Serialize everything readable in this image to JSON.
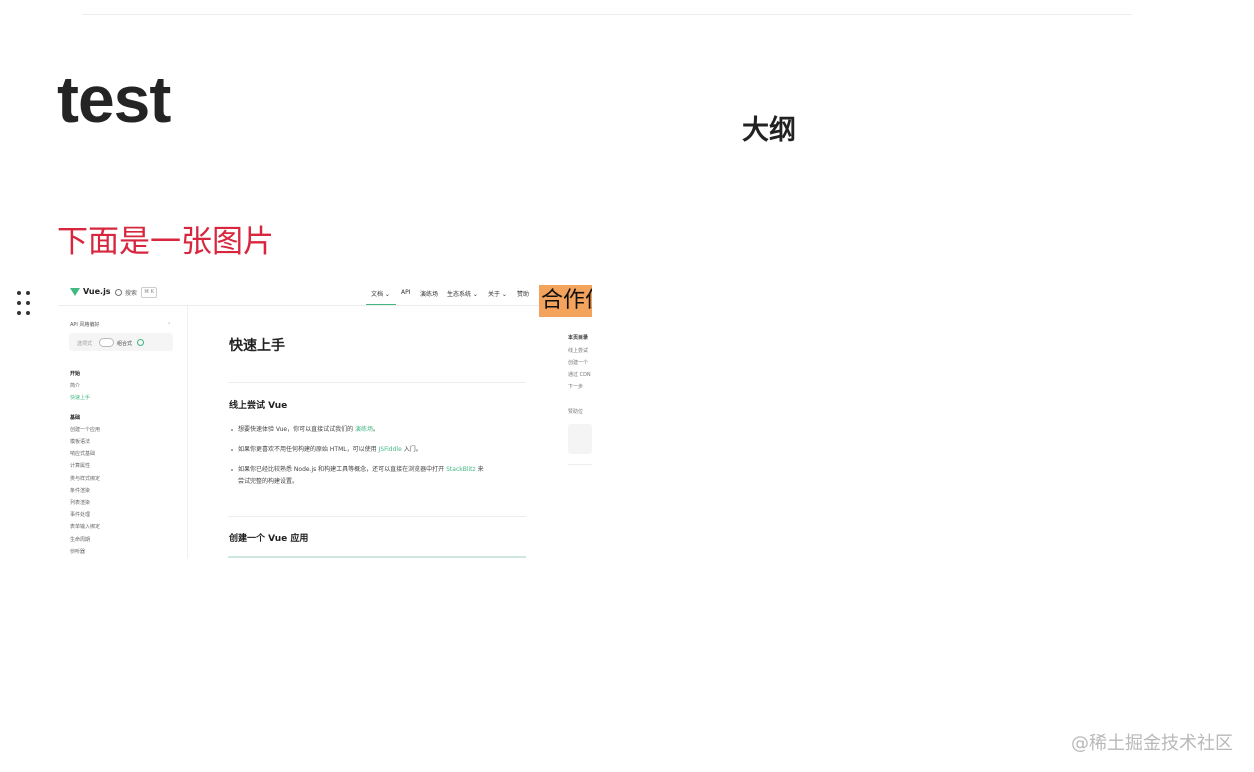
{
  "document": {
    "title": "test",
    "paragraph": "下面是一张图片"
  },
  "outline": {
    "title": "大纲"
  },
  "embedded_screenshot": {
    "nav": {
      "brand": "Vue.js",
      "search_label": "搜索",
      "search_kbd": "⌘ K",
      "links": [
        {
          "label": "文档 ⌄"
        },
        {
          "label": "API"
        },
        {
          "label": "演练场"
        },
        {
          "label": "生态系统 ⌄"
        },
        {
          "label": "关于 ⌄"
        },
        {
          "label": "赞助"
        }
      ],
      "badge": "合作伙伴"
    },
    "sidebar": {
      "pref_label": "API 风格偏好",
      "pref_chevron": "›",
      "option_off": "选项式",
      "option_on": "组合式",
      "items": [
        {
          "label": "开始",
          "kind": "sec"
        },
        {
          "label": "简介",
          "kind": "item"
        },
        {
          "label": "快速上手",
          "kind": "active"
        },
        {
          "label": "基础",
          "kind": "sec"
        },
        {
          "label": "创建一个应用",
          "kind": "item"
        },
        {
          "label": "模板语法",
          "kind": "item"
        },
        {
          "label": "响应式基础",
          "kind": "item"
        },
        {
          "label": "计算属性",
          "kind": "item"
        },
        {
          "label": "类与样式绑定",
          "kind": "item"
        },
        {
          "label": "条件渲染",
          "kind": "item"
        },
        {
          "label": "列表渲染",
          "kind": "item"
        },
        {
          "label": "事件处理",
          "kind": "item"
        },
        {
          "label": "表单输入绑定",
          "kind": "item"
        },
        {
          "label": "生命周期",
          "kind": "item"
        },
        {
          "label": "侦听器",
          "kind": "item"
        }
      ]
    },
    "main": {
      "h1": "快速上手",
      "section1": "线上尝试 Vue",
      "bullet1_pre": "想要快速体验 Vue，你可以直接试试我们的",
      "bullet1_link": "演练场",
      "bullet1_post": "。",
      "bullet2_pre": "如果你更喜欢不用任何构建的原始 HTML，可以使用",
      "bullet2_link": "JSFiddle",
      "bullet2_post": "入门。",
      "bullet3_pre": "如果你已经比较熟悉 Node.js 和构建工具等概念，还可以直接在浏览器中打开",
      "bullet3_link": "StackBlitz",
      "bullet3_post": "来",
      "bullet3_line2": "尝试完整的构建设置。",
      "section2": "创建一个 Vue 应用"
    },
    "toc": {
      "head": "本页目录",
      "items": [
        {
          "label": "线上尝试"
        },
        {
          "label": "创建一个"
        },
        {
          "label": "通过 CDN"
        },
        {
          "label": "下一步"
        }
      ],
      "sponsor": "赞助位"
    }
  },
  "watermark": "@稀土掘金技术社区"
}
